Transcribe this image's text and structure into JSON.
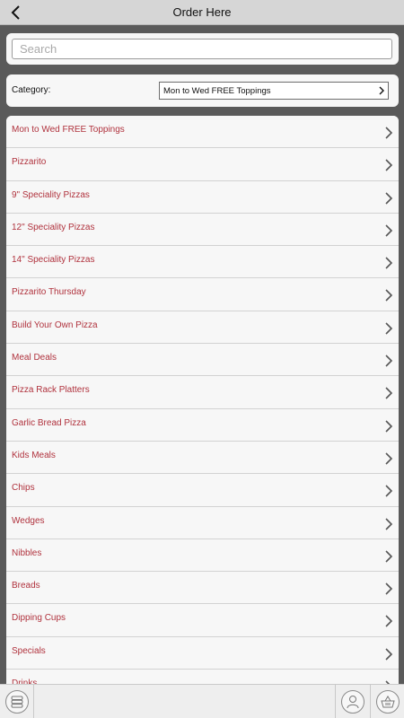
{
  "header": {
    "title": "Order Here",
    "back_icon": "chevron-left-icon"
  },
  "search": {
    "placeholder": "Search",
    "value": ""
  },
  "category": {
    "label": "Category:",
    "selected": "Mon to Wed FREE Toppings"
  },
  "menu": {
    "items": [
      {
        "label": "Mon to Wed FREE Toppings"
      },
      {
        "label": "Pizzarito"
      },
      {
        "label": "9\" Speciality Pizzas"
      },
      {
        "label": "12\" Speciality Pizzas"
      },
      {
        "label": "14\" Speciality Pizzas"
      },
      {
        "label": "Pizzarito Thursday"
      },
      {
        "label": "Build Your Own Pizza"
      },
      {
        "label": "Meal Deals"
      },
      {
        "label": "Pizza Rack Platters"
      },
      {
        "label": "Garlic Bread Pizza"
      },
      {
        "label": "Kids Meals"
      },
      {
        "label": "Chips"
      },
      {
        "label": "Wedges"
      },
      {
        "label": "Nibbles"
      },
      {
        "label": "Breads"
      },
      {
        "label": "Dipping Cups"
      },
      {
        "label": "Specials"
      },
      {
        "label": "Drinks"
      }
    ]
  },
  "bottom_bar": {
    "left_icon": "menu-list-icon",
    "user_icon": "user-icon",
    "basket_icon": "basket-icon"
  },
  "colors": {
    "item_text": "#b0323d",
    "background": "#5a5a5a",
    "panel": "#f7f7f7"
  }
}
